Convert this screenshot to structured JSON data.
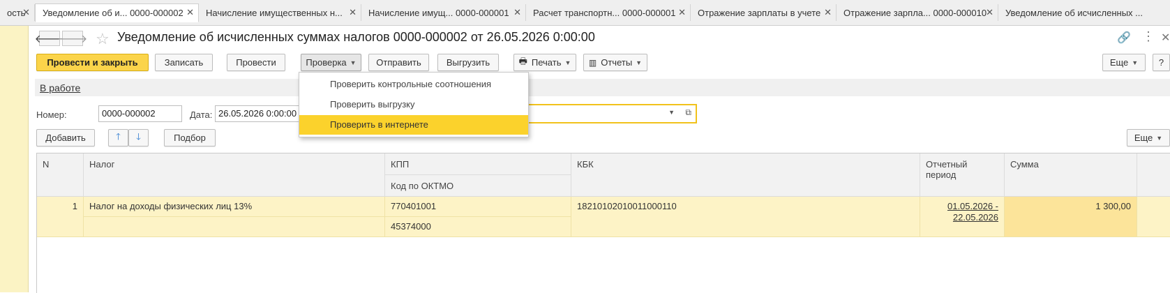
{
  "tabs": [
    {
      "label": "ость",
      "close": "✕"
    },
    {
      "label": "Уведомление об и...  0000-000002",
      "close": "✕",
      "active": true
    },
    {
      "label": "Начисление имущественных н...",
      "close": "✕"
    },
    {
      "label": "Начисление имущ... 0000-000001",
      "close": "✕"
    },
    {
      "label": "Расчет транспортн... 0000-000001",
      "close": "✕"
    },
    {
      "label": "Отражение зарплаты в учете",
      "close": "✕"
    },
    {
      "label": "Отражение зарпла... 0000-000010",
      "close": "✕"
    },
    {
      "label": "Уведомление об исчисленных ...",
      "close": ""
    }
  ],
  "header": {
    "back": "🡐",
    "forward": "🡒",
    "star": "☆",
    "title": "Уведомление об исчисленных суммах налогов 0000-000002 от 26.05.2026 0:00:00",
    "link_icon": "🔗",
    "more_icon": "⋮",
    "close_icon": "✕"
  },
  "toolbar": {
    "post_close": "Провести и закрыть",
    "save": "Записать",
    "post": "Провести",
    "check": "Проверка",
    "send": "Отправить",
    "upload": "Выгрузить",
    "print": "Печать",
    "reports": "Отчеты",
    "more": "Еще",
    "help": "?"
  },
  "status": {
    "link": "В работе"
  },
  "form": {
    "number_label": "Номер:",
    "number_value": "0000-000002",
    "date_label": "Дата:",
    "date_value": "26.05.2026  0:00:00"
  },
  "dropdown": {
    "items": [
      {
        "label": "Проверить контрольные соотношения"
      },
      {
        "label": "Проверить выгрузку"
      },
      {
        "label": "Проверить в интернете",
        "selected": true
      }
    ]
  },
  "table_toolbar": {
    "add": "Добавить",
    "up": "🡑",
    "down": "🡓",
    "select": "Подбор",
    "more": "Еще"
  },
  "table": {
    "headers": {
      "n": "N",
      "tax": "Налог",
      "kpp": "КПП",
      "oktmo": "Код по ОКТМО",
      "kbk": "КБК",
      "period": "Отчетный период",
      "sum": "Сумма"
    },
    "rows": [
      {
        "n": "1",
        "tax": "Налог на доходы физических лиц 13%",
        "kpp": "770401001",
        "oktmo": "45374000",
        "kbk": "18210102010011000110",
        "period_from": "01.05.2026 -",
        "period_to": "22.05.2026",
        "sum": "1 300,00"
      }
    ]
  },
  "colors": {
    "accent": "#fbd44a",
    "row_highlight": "#fdf3c6",
    "menu_selected": "#fbd22c"
  }
}
